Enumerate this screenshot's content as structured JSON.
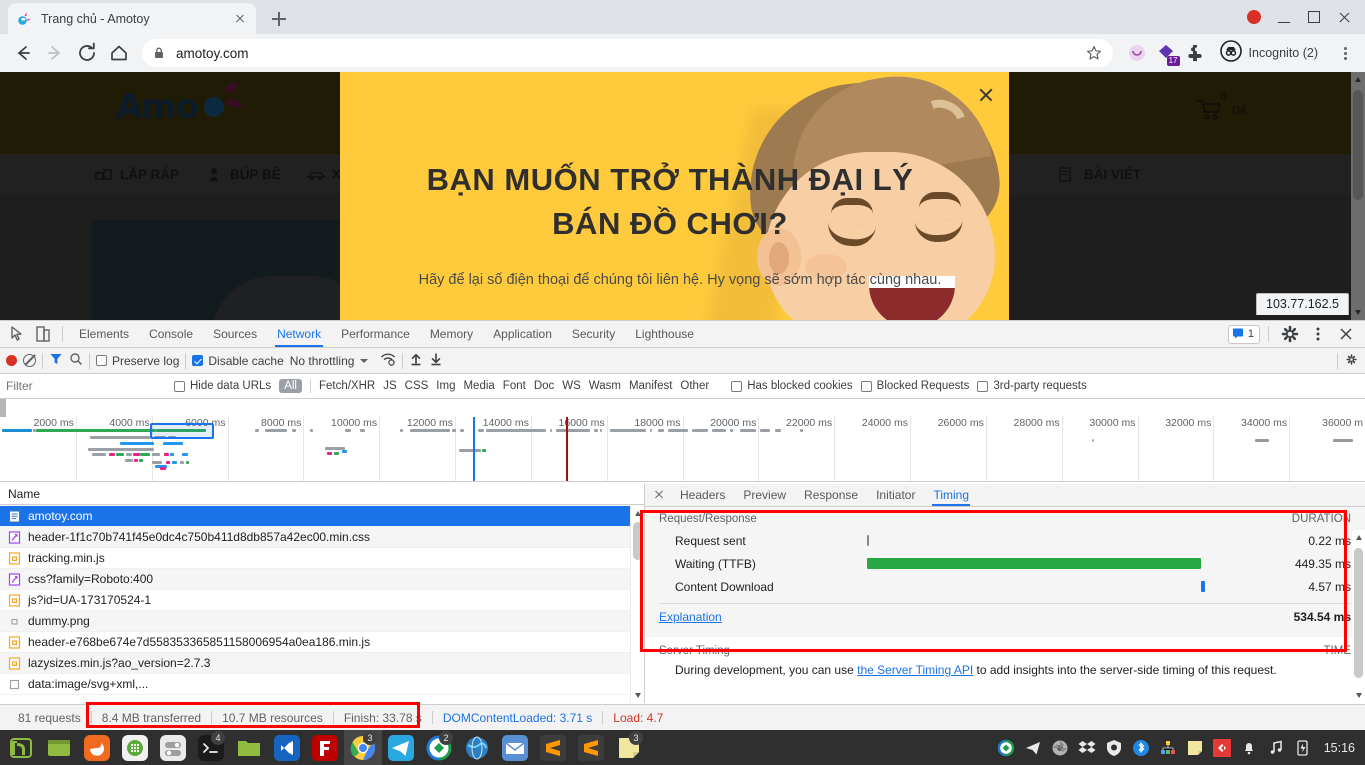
{
  "browser": {
    "tab": {
      "title": "Trang chủ - Amotoy",
      "favicon": "amotoy-favicon-icon",
      "close": "close-icon"
    },
    "newtab_label": "+",
    "window_controls": {
      "record": "record-dot-icon",
      "minimize": "minimize-icon",
      "maximize": "maximize-icon",
      "close": "close-icon"
    },
    "omnibox": {
      "url": "amotoy.com",
      "lock": "lock-icon",
      "star": "star-icon"
    },
    "profile": {
      "label": "Incognito (2)",
      "icon": "incognito-icon"
    },
    "extensions": {
      "badge": "17",
      "puzzle": "extensions-puzzle-icon",
      "pocket": "pocket-icon"
    },
    "status_tooltip": "103.77.162.5"
  },
  "page": {
    "logo": {
      "wordmark": "Amo",
      "tagline": "Vì Một Thế Hệ Thông Minh"
    },
    "nav": [
      {
        "label": "LẮP RÁP",
        "icon": "blocks-icon"
      },
      {
        "label": "BÚP BÊ",
        "icon": "doll-icon"
      },
      {
        "label": "XE ĐIỀU KHIỂN",
        "icon": "car-icon"
      },
      {
        "label": "BÀI VIẾT",
        "icon": "article-icon"
      }
    ],
    "cart": {
      "count": "0",
      "total": "0₫",
      "icon": "cart-icon"
    }
  },
  "modal": {
    "title_line1": "BẠN MUỐN TRỞ THÀNH ĐẠI LÝ",
    "title_line2": "BÁN ĐỒ CHƠI?",
    "subtitle": "Hãy để lại số điện thoại để chúng tôi liên hệ. Hy vọng sẽ sớm hợp tác cùng nhau.",
    "close": "close-icon",
    "background_color": "#ffcb3d"
  },
  "devtools": {
    "panels": [
      {
        "label": "Elements",
        "active": false
      },
      {
        "label": "Console",
        "active": false
      },
      {
        "label": "Sources",
        "active": false
      },
      {
        "label": "Network",
        "active": true
      },
      {
        "label": "Performance",
        "active": false
      },
      {
        "label": "Memory",
        "active": false
      },
      {
        "label": "Application",
        "active": false
      },
      {
        "label": "Security",
        "active": false
      },
      {
        "label": "Lighthouse",
        "active": false
      }
    ],
    "tools": {
      "inspect": "inspect-element-icon",
      "device": "device-toolbar-icon"
    },
    "right": {
      "messages_count": "1",
      "messages_icon": "message-icon",
      "settings": "gear-icon",
      "more": "kebab-icon",
      "close": "close-icon"
    },
    "toolbar": {
      "record_icon": "record-icon",
      "clear_icon": "clear-icon",
      "filter_icon": "filter-funnel-icon",
      "search_icon": "search-icon",
      "preserve_log": {
        "label": "Preserve log",
        "checked": false
      },
      "disable_cache": {
        "label": "Disable cache",
        "checked": true
      },
      "throttling": "No throttling",
      "wifi_icon": "network-conditions-icon",
      "import_icon": "import-har-icon",
      "export_icon": "export-har-icon",
      "settings_icon": "gear-icon"
    },
    "filterbar": {
      "filter_placeholder": "Filter",
      "filter_value": "",
      "hide_data_urls": {
        "label": "Hide data URLs",
        "checked": false
      },
      "types": [
        "All",
        "Fetch/XHR",
        "JS",
        "CSS",
        "Img",
        "Media",
        "Font",
        "Doc",
        "WS",
        "Wasm",
        "Manifest",
        "Other"
      ],
      "active_type": "All",
      "has_blocked_cookies": {
        "label": "Has blocked cookies",
        "checked": false
      },
      "blocked_requests": {
        "label": "Blocked Requests",
        "checked": false
      },
      "third_party": {
        "label": "3rd-party requests",
        "checked": false
      }
    },
    "overview": {
      "ticks": [
        "2000 ms",
        "4000 ms",
        "6000 ms",
        "8000 ms",
        "10000 ms",
        "12000 ms",
        "14000 ms",
        "16000 ms",
        "18000 ms",
        "20000 ms",
        "22000 ms",
        "24000 ms",
        "26000 ms",
        "28000 ms",
        "30000 ms",
        "32000 ms",
        "34000 ms",
        "36000 m"
      ],
      "dom_content_loaded_color": "#1a73e8",
      "load_color": "#a50e0e"
    },
    "requests": {
      "column_header": "Name",
      "rows": [
        {
          "name": "amotoy.com",
          "type": "doc",
          "selected": true
        },
        {
          "name": "header-1f1c70b741f45e0dc4c750b411d8db857a42ec00.min.css",
          "type": "css",
          "selected": false
        },
        {
          "name": "tracking.min.js",
          "type": "js",
          "selected": false
        },
        {
          "name": "css?family=Roboto:400",
          "type": "css",
          "selected": false
        },
        {
          "name": "js?id=UA-173170524-1",
          "type": "js",
          "selected": false
        },
        {
          "name": "dummy.png",
          "type": "img",
          "selected": false
        },
        {
          "name": "header-e768be674e7d558353365851158006954a0ea186.min.js",
          "type": "js",
          "selected": false
        },
        {
          "name": "lazysizes.min.js?ao_version=2.7.3",
          "type": "js",
          "selected": false
        },
        {
          "name": "data:image/svg+xml,...",
          "type": "other",
          "selected": false
        }
      ]
    },
    "detail": {
      "tabs": [
        {
          "label": "Headers",
          "active": false
        },
        {
          "label": "Preview",
          "active": false
        },
        {
          "label": "Response",
          "active": false
        },
        {
          "label": "Initiator",
          "active": false
        },
        {
          "label": "Timing",
          "active": true
        }
      ],
      "close_icon": "close-icon",
      "timing": {
        "section_title": "Request/Response",
        "duration_header": "DURATION",
        "rows": [
          {
            "label": "Request sent",
            "duration": "0.22 ms",
            "bar_start_pct": 0.0,
            "bar_width_pct": 0.3,
            "color": "#888888"
          },
          {
            "label": "Waiting (TTFB)",
            "duration": "449.35 ms",
            "bar_start_pct": 0.0,
            "bar_width_pct": 84.0,
            "color": "#28a745"
          },
          {
            "label": "Content Download",
            "duration": "4.57 ms",
            "bar_start_pct": 84.0,
            "bar_width_pct": 0.9,
            "color": "#1a73e8"
          }
        ],
        "explanation_label": "Explanation",
        "total": "534.54 ms"
      },
      "server_timing": {
        "title": "Server Timing",
        "time_header": "TIME",
        "text_before": "During development, you can use ",
        "link": "the Server Timing API",
        "text_after": " to add insights into the server-side timing of this request."
      }
    },
    "status": {
      "requests": "81 requests",
      "transferred": "8.4 MB transferred",
      "resources": "10.7 MB resources",
      "finish": "Finish: 33.78 s",
      "dom_content_loaded": "DOMContentLoaded: 3.71 s",
      "load": "Load: 4.7"
    }
  },
  "taskbar": {
    "apps": [
      {
        "name": "linux-mint-menu-icon",
        "badge": ""
      },
      {
        "name": "window-manager-icon",
        "badge": ""
      },
      {
        "name": "firefox-icon",
        "badge": ""
      },
      {
        "name": "app-grid-icon",
        "badge": ""
      },
      {
        "name": "settings-toggle-icon",
        "badge": ""
      },
      {
        "name": "terminal-icon",
        "badge": "4"
      },
      {
        "name": "file-manager-icon",
        "badge": ""
      },
      {
        "name": "vscode-icon",
        "badge": ""
      },
      {
        "name": "filezilla-icon",
        "badge": ""
      },
      {
        "name": "chrome-icon",
        "badge": "3"
      },
      {
        "name": "telegram-icon",
        "badge": ""
      },
      {
        "name": "anydesk-icon",
        "badge": "2"
      },
      {
        "name": "globe-icon",
        "badge": ""
      },
      {
        "name": "mail-icon",
        "badge": ""
      },
      {
        "name": "sublime-text-icon",
        "badge": ""
      },
      {
        "name": "sublime-text-icon",
        "badge": ""
      },
      {
        "name": "sticky-notes-icon",
        "badge": "3"
      }
    ],
    "tray": [
      "anydesk-tray-icon",
      "telegram-tray-icon",
      "shutter-tray-icon",
      "dropbox-tray-icon",
      "shield-tray-icon",
      "bluetooth-tray-icon",
      "network-tray-icon",
      "notes-tray-icon",
      "nomachine-tray-icon",
      "bell-tray-icon",
      "music-tray-icon",
      "battery-tray-icon"
    ],
    "clock": "15:16"
  }
}
